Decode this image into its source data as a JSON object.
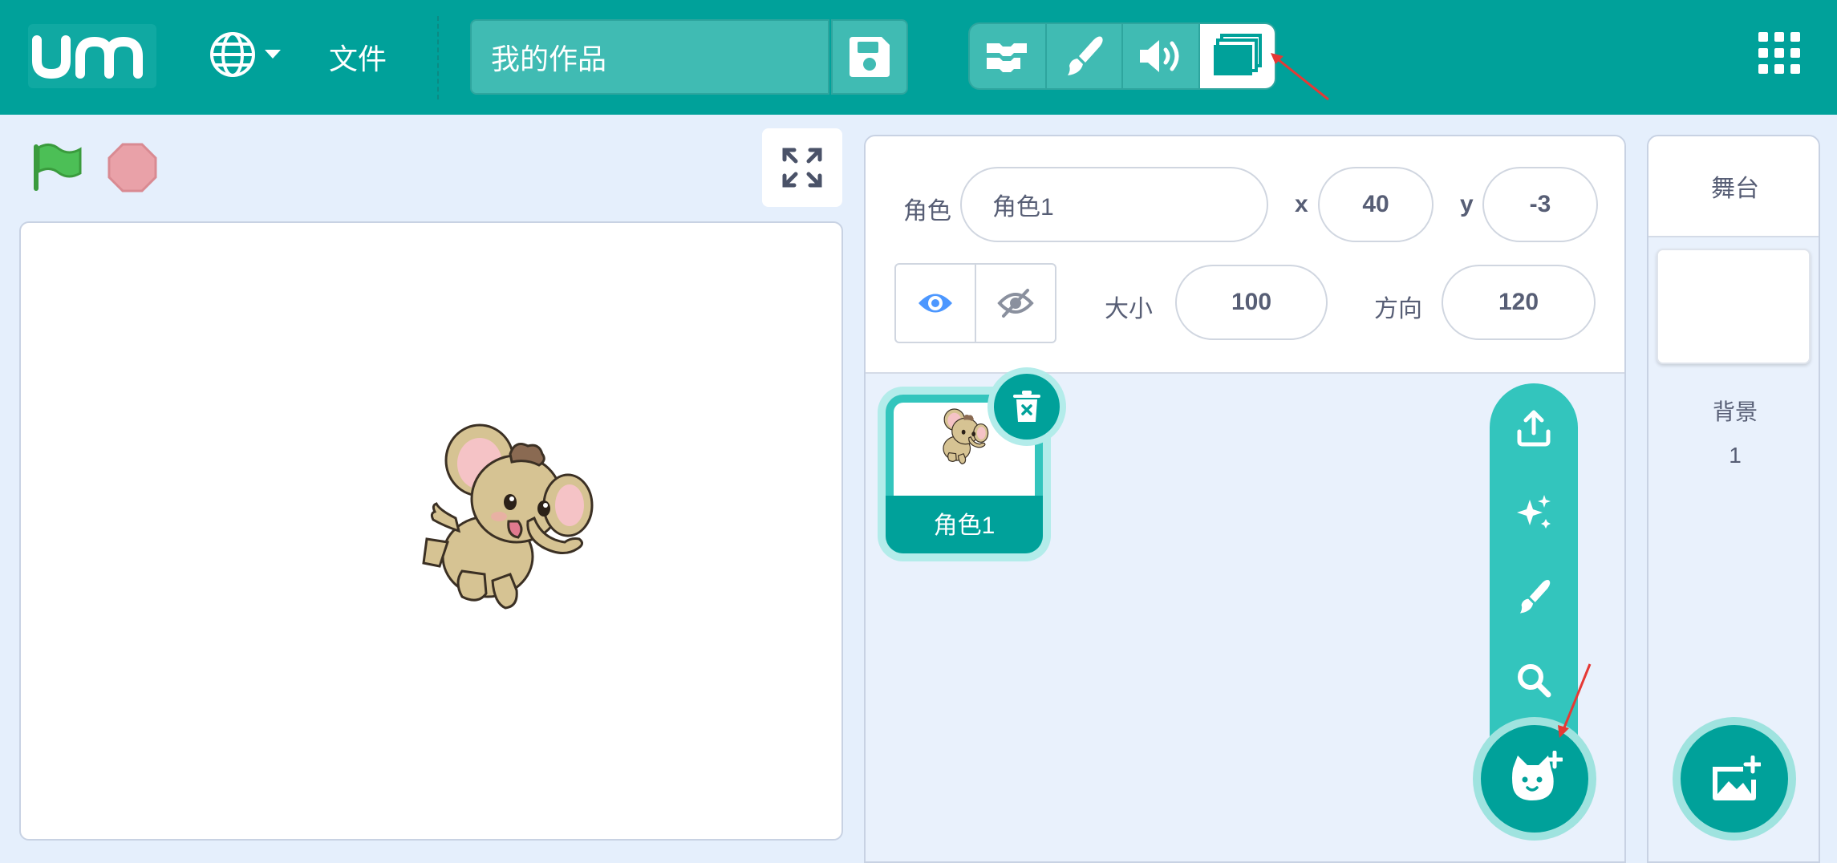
{
  "menubar": {
    "file_label": "文件",
    "project_title": "我的作品",
    "mode_tabs": [
      {
        "icon": "code-blocks-icon",
        "active": false
      },
      {
        "icon": "paint-brush-icon",
        "active": false
      },
      {
        "icon": "sound-icon",
        "active": false
      },
      {
        "icon": "stage-layers-icon",
        "active": true
      }
    ]
  },
  "sprite_info": {
    "sprite_label": "角色",
    "sprite_name": "角色1",
    "x_label": "x",
    "x_value": "40",
    "y_label": "y",
    "y_value": "-3",
    "size_label": "大小",
    "size_value": "100",
    "direction_label": "方向",
    "direction_value": "120"
  },
  "sprites": [
    {
      "name": "角色1",
      "selected": true
    }
  ],
  "stage_panel": {
    "title": "舞台",
    "backdrop_label": "背景",
    "backdrop_count": "1"
  },
  "colors": {
    "brand": "#00a19a",
    "accent_light": "#33c5bd",
    "background": "#e5effc",
    "annotation_arrow": "#e53935"
  }
}
